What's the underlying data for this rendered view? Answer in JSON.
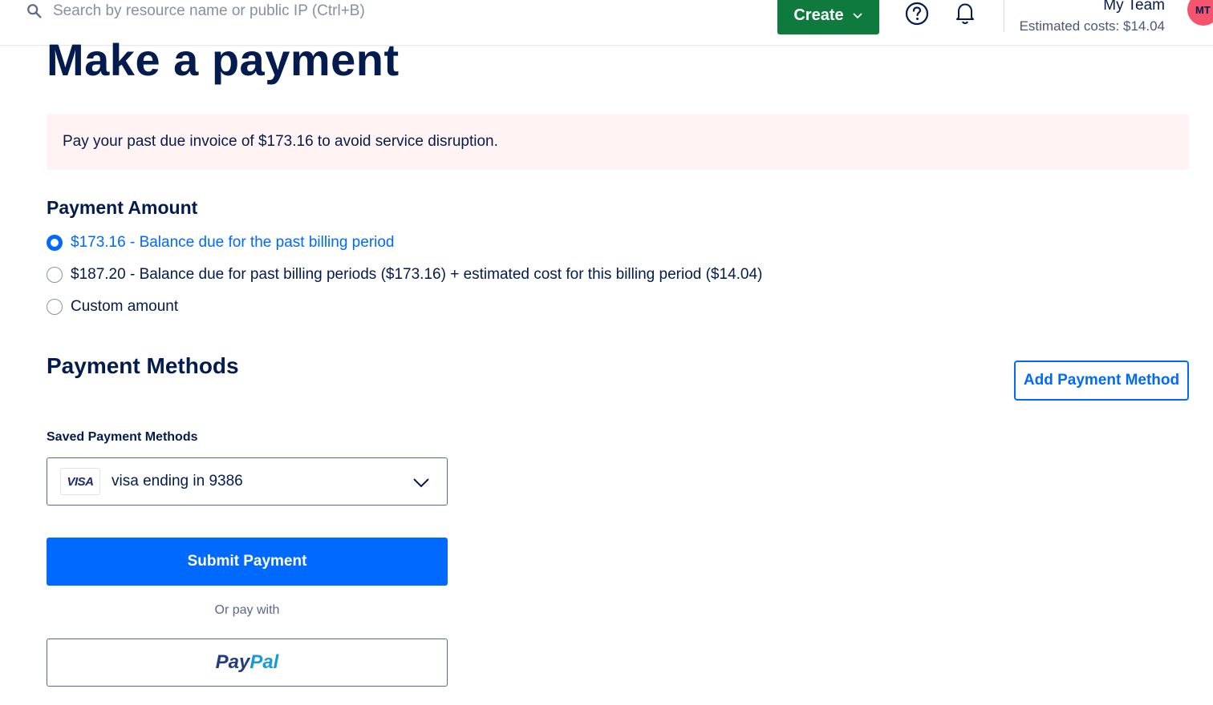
{
  "header": {
    "search_placeholder": "Search by resource name or public IP (Ctrl+B)",
    "create_label": "Create",
    "team_name": "My Team",
    "estimated_costs": "Estimated costs: $14.04",
    "avatar_initials": "MT"
  },
  "page": {
    "title": "Make a payment",
    "alert_text": "Pay your past due invoice of $173.16 to avoid service disruption."
  },
  "payment_amount": {
    "heading": "Payment Amount",
    "options": [
      {
        "label": "$173.16 - Balance due for the past billing period",
        "selected": true
      },
      {
        "label": "$187.20 - Balance due for past billing periods ($173.16) + estimated cost for this billing period ($14.04)",
        "selected": false
      },
      {
        "label": "Custom amount",
        "selected": false
      }
    ]
  },
  "payment_methods": {
    "heading": "Payment Methods",
    "add_button": "Add Payment Method",
    "saved_label": "Saved Payment Methods",
    "card_brand": "VISA",
    "selected_method": "visa ending in 9386",
    "submit_label": "Submit Payment",
    "or_pay_with": "Or pay with",
    "paypal_part1": "Pay",
    "paypal_part2": "Pal"
  },
  "colors": {
    "primary": "#0069ff",
    "create_green": "#0f7a3d",
    "alert_bg": "#fff4f3",
    "text_navy": "#031b4e",
    "avatar_bg": "#f5546d"
  }
}
